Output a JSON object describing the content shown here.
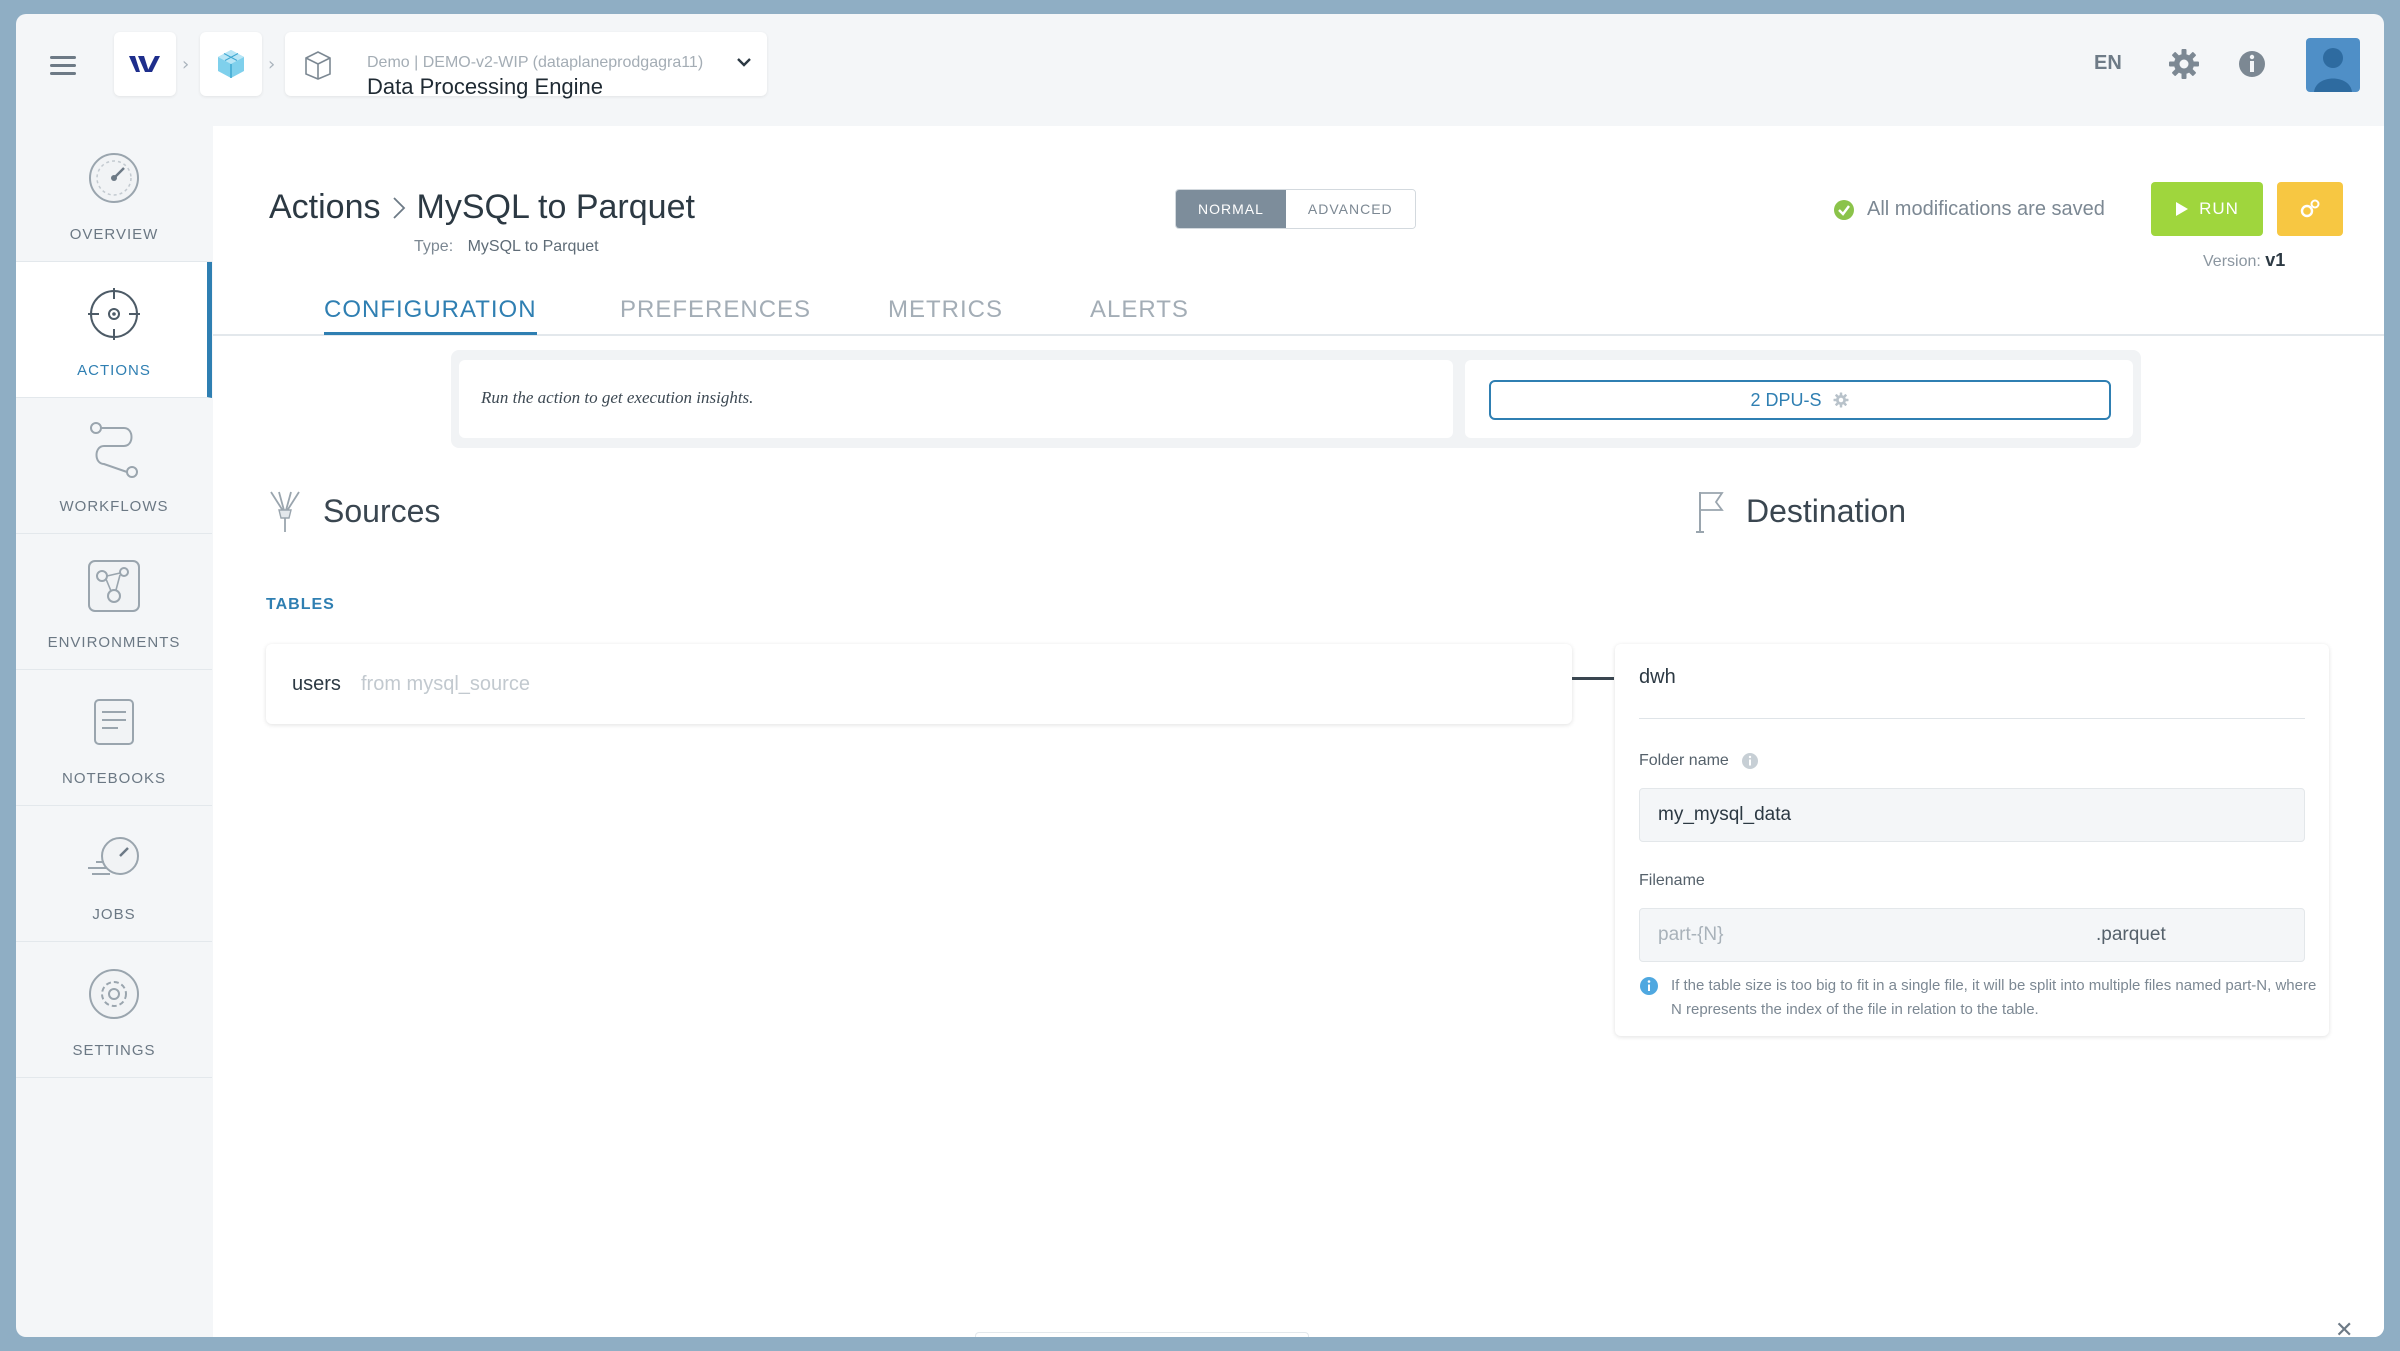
{
  "topbar": {
    "project_sub": "Demo | DEMO-v2-WIP (dataplaneprodgagra11)",
    "project_title": "Data Processing Engine",
    "language": "EN",
    "icons": [
      "menu-icon",
      "logo-icon",
      "cube-icon",
      "box-icon",
      "chevron-down-icon",
      "gear-icon",
      "info-icon",
      "user-avatar"
    ]
  },
  "sidebar": {
    "items": [
      {
        "label": "OVERVIEW",
        "icon": "gauge-icon"
      },
      {
        "label": "ACTIONS",
        "icon": "target-icon"
      },
      {
        "label": "WORKFLOWS",
        "icon": "workflow-icon"
      },
      {
        "label": "ENVIRONMENTS",
        "icon": "network-icon"
      },
      {
        "label": "NOTEBOOKS",
        "icon": "notebook-icon"
      },
      {
        "label": "JOBS",
        "icon": "timer-icon"
      },
      {
        "label": "SETTINGS",
        "icon": "settings-icon"
      }
    ],
    "active": "ACTIONS"
  },
  "header": {
    "breadcrumb_root": "Actions",
    "breadcrumb_current": "MySQL to Parquet",
    "type_label": "Type:",
    "type_value": "MySQL to Parquet",
    "mode_normal": "NORMAL",
    "mode_advanced": "ADVANCED",
    "saved_status": "All modifications are saved",
    "run_label": "RUN",
    "version_label": "Version:",
    "version_value": "v1"
  },
  "tabs": [
    "CONFIGURATION",
    "PREFERENCES",
    "METRICS",
    "ALERTS"
  ],
  "insights": {
    "message": "Run the action to get execution insights.",
    "dpu_label": "2 DPU-S"
  },
  "sources": {
    "title": "Sources",
    "tables_label": "TABLES",
    "rows": [
      {
        "name": "users",
        "from": "from mysql_source"
      }
    ]
  },
  "destination": {
    "title": "Destination",
    "name": "dwh",
    "folder_label": "Folder name",
    "folder_value": "my_mysql_data",
    "filename_label": "Filename",
    "filename_placeholder": "part-{N}",
    "filename_suffix": ".parquet",
    "hint": "If the table size is too big to fit in a single file, it will be split into multiple files named part-N, where N represents the index of the file in relation to the table."
  },
  "colors": {
    "accent": "#2f7fb2",
    "run": "#9fd63d",
    "schedule": "#f7c742",
    "saved_check": "#8bc34a"
  }
}
